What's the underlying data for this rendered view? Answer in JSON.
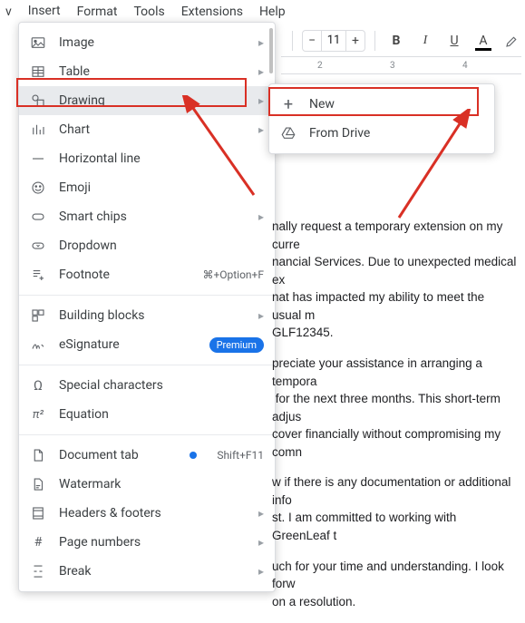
{
  "menubar": {
    "items": [
      "Insert",
      "Format",
      "Tools",
      "Extensions",
      "Help"
    ],
    "prefix": "v"
  },
  "toolbar": {
    "fontsize": "11",
    "minus": "−",
    "plus": "+",
    "bold": "B",
    "italic": "I",
    "underline": "U",
    "textcolor": "A"
  },
  "ruler": {
    "marks": [
      "2",
      "3",
      "4"
    ]
  },
  "menu": {
    "image": "Image",
    "table": "Table",
    "drawing": "Drawing",
    "chart": "Chart",
    "hrule": "Horizontal line",
    "emoji": "Emoji",
    "smartchips": "Smart chips",
    "dropdown": "Dropdown",
    "footnote": "Footnote",
    "footnote_hint": "⌘+Option+F",
    "blocks": "Building blocks",
    "esig": "eSignature",
    "esig_badge": "Premium",
    "special": "Special characters",
    "equation": "Equation",
    "doctab": "Document tab",
    "doctab_hint": "Shift+F11",
    "watermark": "Watermark",
    "headers": "Headers & footers",
    "pagenum": "Page numbers",
    "break": "Break"
  },
  "submenu": {
    "new": "New",
    "drive": "From Drive"
  },
  "doc": {
    "p1": "nally request a temporary extension on my curre",
    "p2": "nancial Services. Due to unexpected medical ex",
    "p3": "nat has impacted my ability to meet the usual m",
    "p4": "GLF12345.",
    "p5": "preciate your assistance in arranging a tempora",
    "p6": " for the next three months. This short-term adjus",
    "p7": "cover financially without compromising my comn",
    "p8": "w if there is any documentation or additional info",
    "p9": "st. I am committed to working with GreenLeaf t",
    "p10": "uch for your time and understanding. I look forw",
    "p11": "on a resolution."
  }
}
